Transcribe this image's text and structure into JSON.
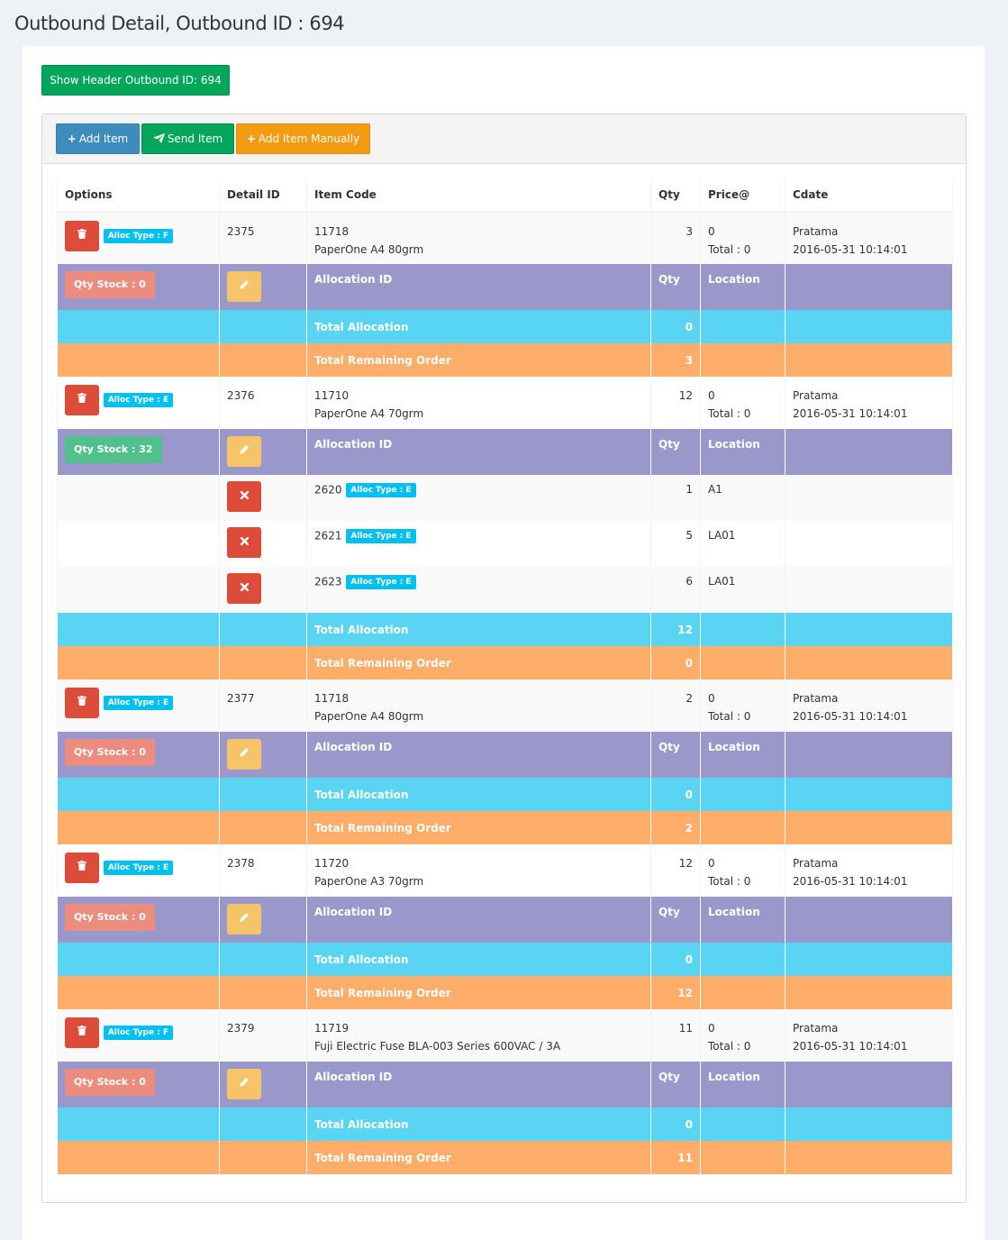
{
  "title": "Outbound Detail, Outbound ID : 694",
  "header_button": "Show Header Outbound ID: 694",
  "toolbar": {
    "add_item": "Add Item",
    "send_item": "Send Item",
    "add_manual": "Add Item Manually"
  },
  "columns": {
    "options": "Options",
    "detail_id": "Detail ID",
    "item_code": "Item Code",
    "qty": "Qty",
    "price": "Price@",
    "cdate": "Cdate"
  },
  "alloc_columns": {
    "allocation_id": "Allocation ID",
    "qty": "Qty",
    "location": "Location"
  },
  "labels": {
    "total_allocation": "Total Allocation",
    "total_remaining": "Total Remaining Order",
    "total_prefix": "Total : "
  },
  "items": [
    {
      "alloc_type": "Alloc Type : F",
      "detail_id": "2375",
      "item_code": "11718",
      "item_name": "PaperOne A4 80grm",
      "qty": "3",
      "price": "0",
      "total": "Total : 0",
      "user": "Pratama",
      "cdate": "2016-05-31 10:14:01",
      "qty_stock": "Qty Stock : 0",
      "allocations": [],
      "total_allocation": "0",
      "total_remaining": "3"
    },
    {
      "alloc_type": "Alloc Type : E",
      "detail_id": "2376",
      "item_code": "11710",
      "item_name": "PaperOne A4 70grm",
      "qty": "12",
      "price": "0",
      "total": "Total : 0",
      "user": "Pratama",
      "cdate": "2016-05-31 10:14:01",
      "qty_stock": "Qty Stock : 32",
      "allocations": [
        {
          "id": "2620",
          "alloc_type": "Alloc Type : E",
          "qty": "1",
          "location": "A1"
        },
        {
          "id": "2621",
          "alloc_type": "Alloc Type : E",
          "qty": "5",
          "location": "LA01"
        },
        {
          "id": "2623",
          "alloc_type": "Alloc Type : E",
          "qty": "6",
          "location": "LA01"
        }
      ],
      "total_allocation": "12",
      "total_remaining": "0"
    },
    {
      "alloc_type": "Alloc Type : E",
      "detail_id": "2377",
      "item_code": "11718",
      "item_name": "PaperOne A4 80grm",
      "qty": "2",
      "price": "0",
      "total": "Total : 0",
      "user": "Pratama",
      "cdate": "2016-05-31 10:14:01",
      "qty_stock": "Qty Stock : 0",
      "allocations": [],
      "total_allocation": "0",
      "total_remaining": "2"
    },
    {
      "alloc_type": "Alloc Type : E",
      "detail_id": "2378",
      "item_code": "11720",
      "item_name": "PaperOne A3 70grm",
      "qty": "12",
      "price": "0",
      "total": "Total : 0",
      "user": "Pratama",
      "cdate": "2016-05-31 10:14:01",
      "qty_stock": "Qty Stock : 0",
      "allocations": [],
      "total_allocation": "0",
      "total_remaining": "12"
    },
    {
      "alloc_type": "Alloc Type : F",
      "detail_id": "2379",
      "item_code": "11719",
      "item_name": "Fuji Electric Fuse BLA-003 Series 600VAC / 3A",
      "qty": "11",
      "price": "0",
      "total": "Total : 0",
      "user": "Pratama",
      "cdate": "2016-05-31 10:14:01",
      "qty_stock": "Qty Stock : 0",
      "allocations": [],
      "total_allocation": "0",
      "total_remaining": "11"
    }
  ],
  "icons": {
    "trash": "trash-icon",
    "pencil": "pencil-icon",
    "remove": "times-icon",
    "plus": "plus-icon",
    "send": "paper-plane-icon"
  },
  "colors": {
    "allocation_header": "#9a98cb",
    "total_allocation": "#59d4f3",
    "total_remaining": "#ffad69",
    "danger": "#dd4b39",
    "warning": "#f6c468",
    "info": "#00c0ef",
    "success": "#00a65a",
    "primary": "#3c8dbc"
  }
}
